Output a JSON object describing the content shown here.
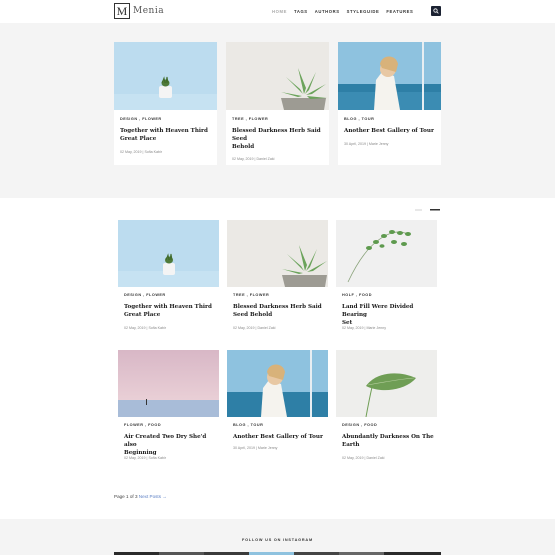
{
  "header": {
    "logo_letter": "M",
    "logo_text": "Menia",
    "nav": [
      "HOME",
      "TAGS",
      "AUTHORS",
      "STYLEGUIDE",
      "FEATURES"
    ],
    "active_nav": "HOME"
  },
  "featured": [
    {
      "category": "DESIGN , FLOWER",
      "title_1": "Together with Heaven Third",
      "title_2": "Great Place",
      "meta": "02 May, 2019 | Sofia Kabir"
    },
    {
      "category": "TREE , FLOWER",
      "title_1": "Blessed Darkness Herb Said Seed",
      "title_2": "Behold",
      "meta": "02 May, 2019 | Daniel Zaki"
    },
    {
      "category": "BLOG , TOUR",
      "title_1": "Another Best Gallery of Tour",
      "title_2": "",
      "meta": "30 April, 2019 | Marie Jenny"
    }
  ],
  "posts": [
    {
      "category": "DESIGN , FLOWER",
      "title_1": "Together with Heaven Third",
      "title_2": "Great Place",
      "meta": "02 May, 2019 | Sofia Kabir"
    },
    {
      "category": "TREE , FLOWER",
      "title_1": "Blessed Darkness Herb Said",
      "title_2": "Seed Behold",
      "meta": "02 May, 2019 | Daniel Zaki"
    },
    {
      "category": "HOLF , FOOD",
      "title_1": "Land Fill Were Divided Bearing",
      "title_2": "Set",
      "meta": "02 May, 2019 | Marie Jenny"
    },
    {
      "category": "FLOWER , FOOD",
      "title_1": "Air Created Two Dry She'd also",
      "title_2": "Beginning",
      "meta": "02 May, 2019 | Sofia Kabir"
    },
    {
      "category": "BLOG , TOUR",
      "title_1": "Another Best Gallery of Tour",
      "title_2": "",
      "meta": "30 April, 2019 | Marie Jenny"
    },
    {
      "category": "DESIGN , FOOD",
      "title_1": "Abundantly Darkness On The",
      "title_2": "Earth",
      "meta": "02 May, 2019 | Daniel Zaki"
    }
  ],
  "pagination": {
    "page_text": "Page 1 of 3",
    "next_text": "Next Posts →"
  },
  "footer": {
    "instagram": "FOLLOW US ON INSTAGRAM"
  },
  "colors": {
    "header_dark": "#1b2232",
    "bg_gray": "#f4f4f4",
    "link": "#5b7fc4"
  }
}
